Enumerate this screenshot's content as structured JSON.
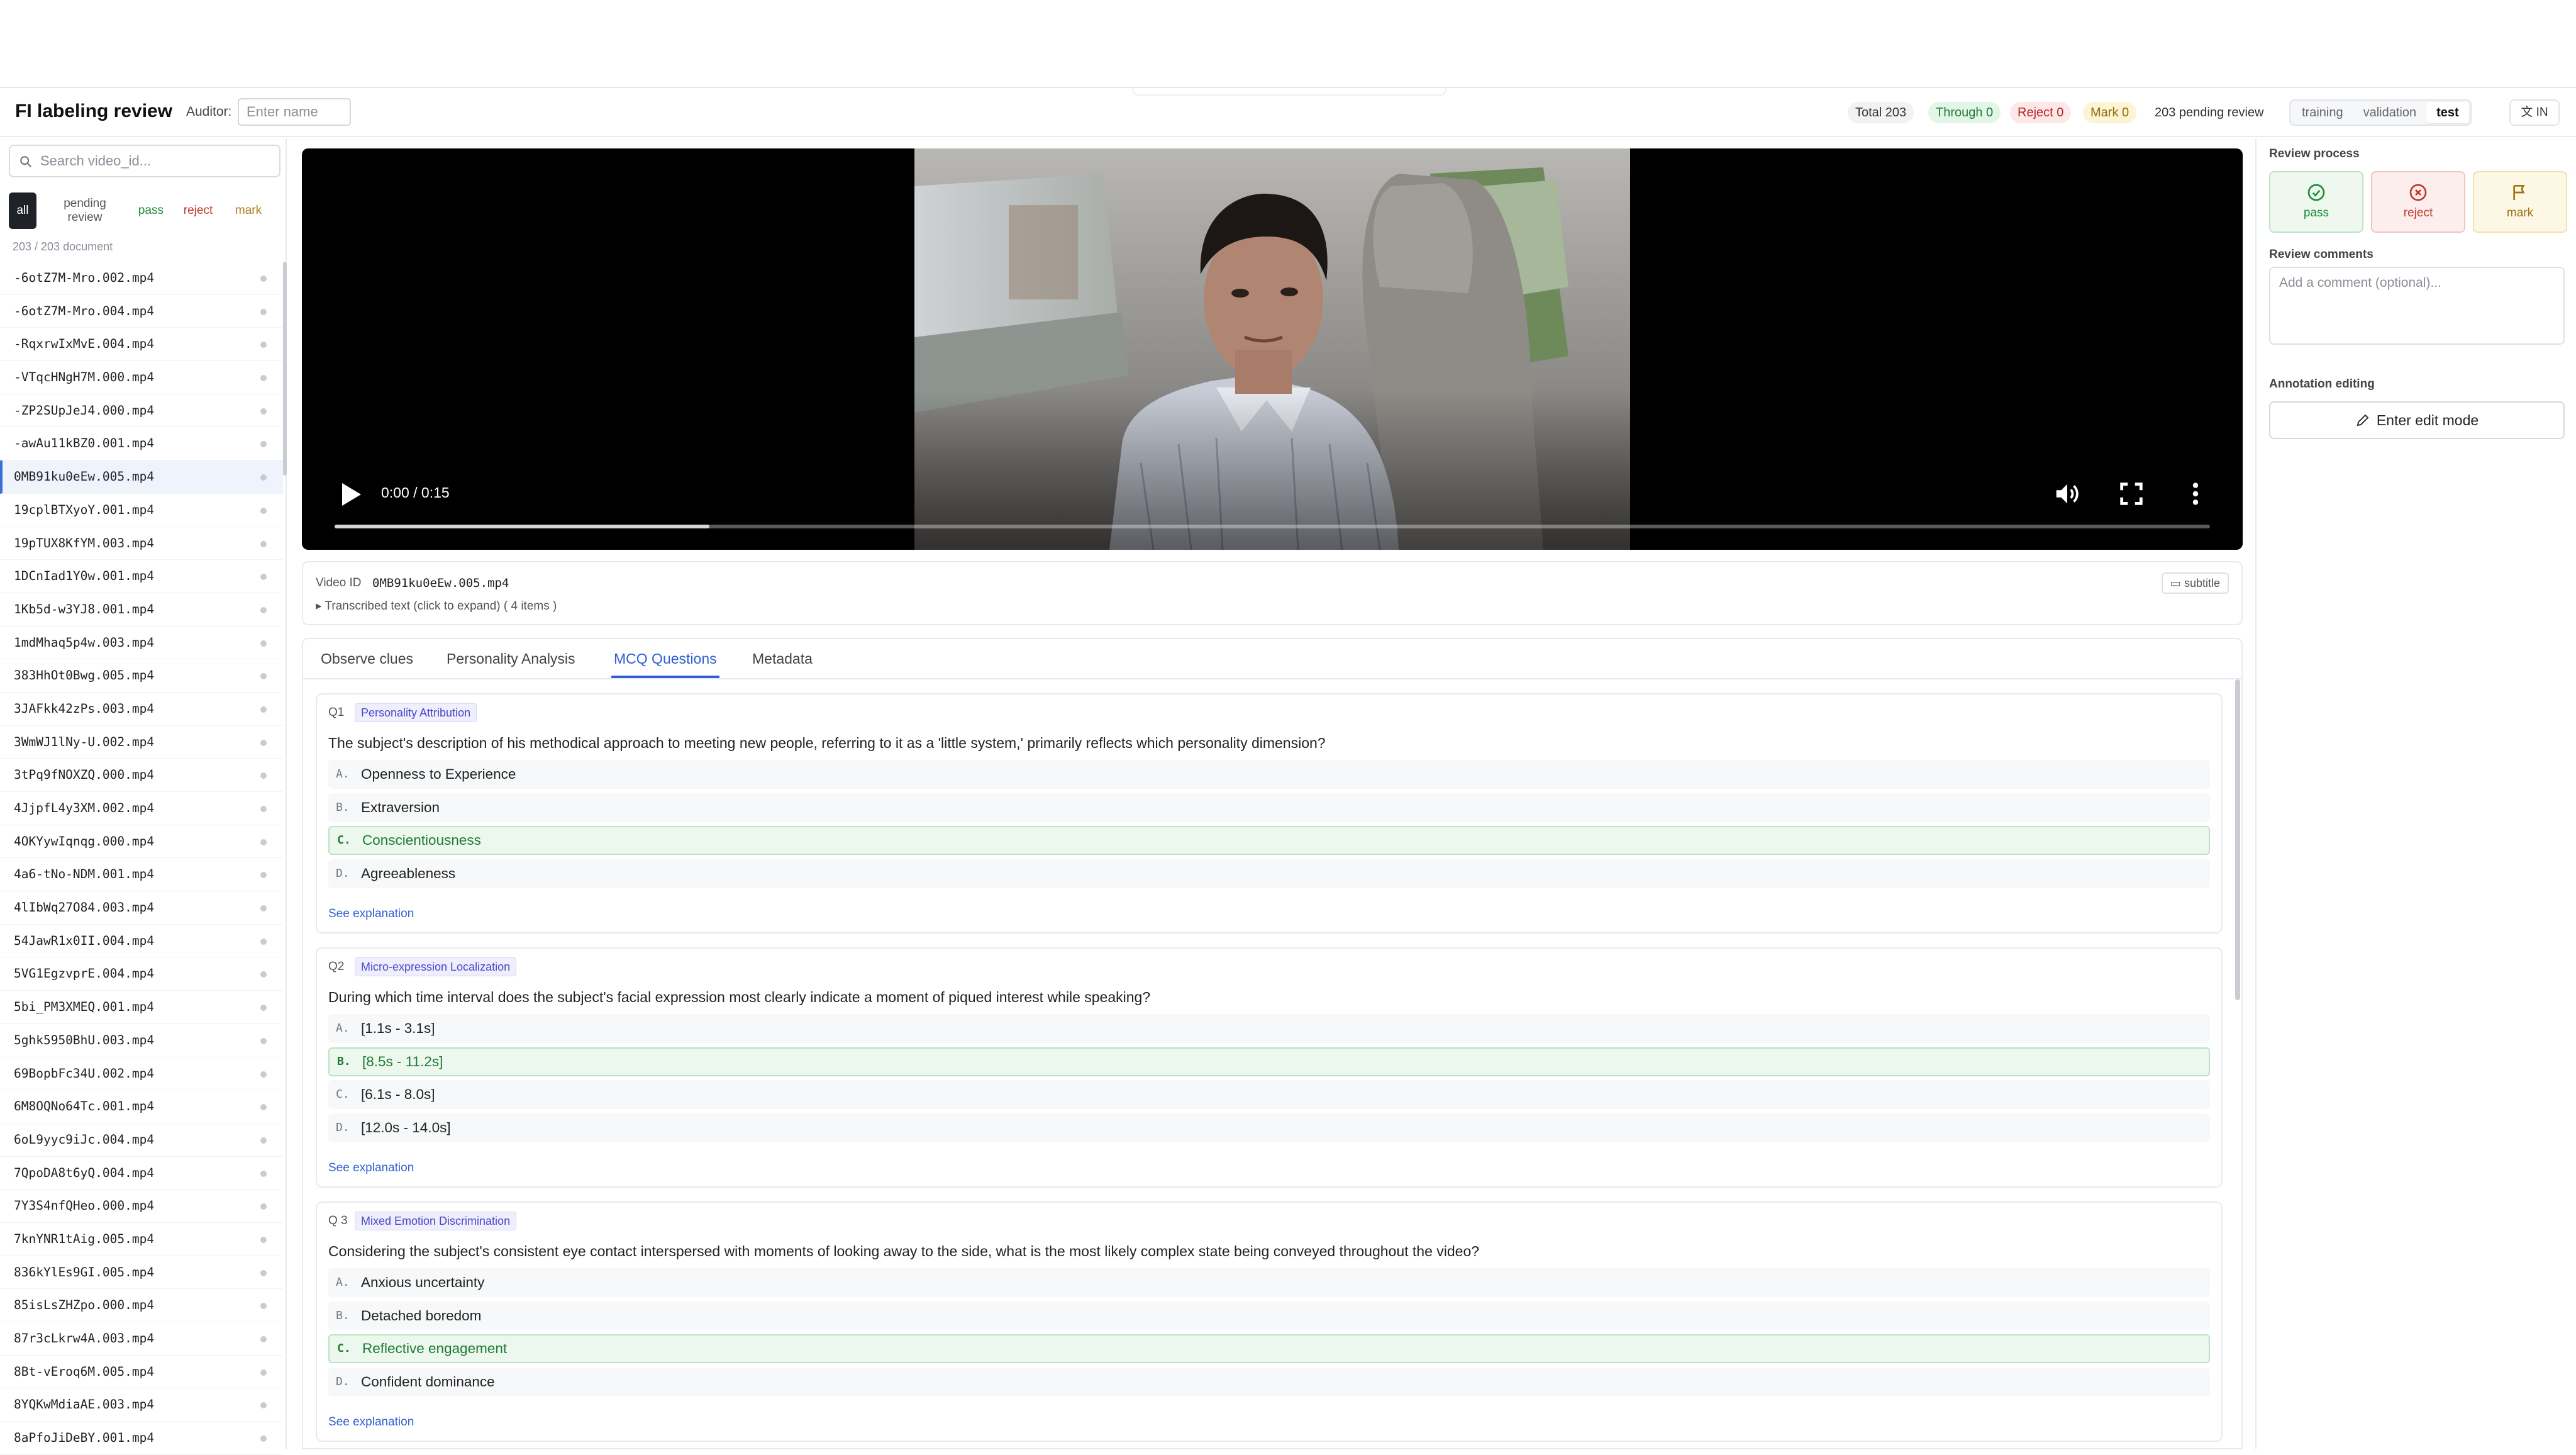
{
  "header": {
    "title": "FI labeling review",
    "auditor_label": "Auditor:",
    "auditor_placeholder": "Enter name",
    "stats": {
      "total": "Total 203",
      "through": "Through 0",
      "reject": "Reject 0",
      "mark": "Mark 0",
      "pending": "203 pending review"
    },
    "splits": [
      "training",
      "validation",
      "test"
    ],
    "active_split": "test",
    "language_button": "IN"
  },
  "sidebar": {
    "search_placeholder": "Search video_id...",
    "filters": {
      "all": "all",
      "pending": "pending review",
      "pass": "pass",
      "reject": "reject",
      "mark": "mark"
    },
    "doc_count": "203 / 203 document",
    "active_file": "0MB91ku0eEw.005.mp4",
    "files": [
      "-6otZ7M-Mro.002.mp4",
      "-6otZ7M-Mro.004.mp4",
      "-RqxrwIxMvE.004.mp4",
      "-VTqcHNgH7M.000.mp4",
      "-ZP2SUpJeJ4.000.mp4",
      "-awAu11kBZ0.001.mp4",
      "0MB91ku0eEw.005.mp4",
      "19cplBTXyoY.001.mp4",
      "19pTUX8KfYM.003.mp4",
      "1DCnIad1Y0w.001.mp4",
      "1Kb5d-w3YJ8.001.mp4",
      "1mdMhaq5p4w.003.mp4",
      "383HhOt0Bwg.005.mp4",
      "3JAFkk42zPs.003.mp4",
      "3WmWJ1lNy-U.002.mp4",
      "3tPq9fNOXZQ.000.mp4",
      "4JjpfL4y3XM.002.mp4",
      "4OKYywIqnqg.000.mp4",
      "4a6-tNo-NDM.001.mp4",
      "4lIbWq27O84.003.mp4",
      "54JawR1x0II.004.mp4",
      "5VG1EgzvprE.004.mp4",
      "5bi_PM3XMEQ.001.mp4",
      "5ghk5950BhU.003.mp4",
      "69BopbFc34U.002.mp4",
      "6M8OQNo64Tc.001.mp4",
      "6oL9yyc9iJc.004.mp4",
      "7QpoDA8t6yQ.004.mp4",
      "7Y3S4nfQHeo.000.mp4",
      "7knYNR1tAig.005.mp4",
      "836kYlEs9GI.005.mp4",
      "85isLsZHZpo.000.mp4",
      "87r3cLkrw4A.003.mp4",
      "8Bt-vEroq6M.005.mp4",
      "8YQKwMdiaAE.003.mp4",
      "8aPfoJiDeBY.001.mp4"
    ]
  },
  "player": {
    "time": "0:00 / 0:15",
    "progress_fraction": 0.2
  },
  "video_info": {
    "id_label": "Video ID",
    "id_value": "0MB91ku0eEw.005.mp4",
    "transcript_toggle": "▸ Transcribed text (click to expand) ( 4 items )",
    "subtitle_button": "subtitle"
  },
  "tabs": [
    "Observe clues",
    "Personality Analysis",
    "MCQ Questions",
    "Metadata"
  ],
  "active_tab": "MCQ Questions",
  "questions": [
    {
      "num": "Q1",
      "tag": "Personality Attribution",
      "text": "The subject's description of his methodical approach to meeting new people, referring to it as a 'little system,' primarily reflects which personality dimension?",
      "options": [
        {
          "letter": "A.",
          "text": "Openness to Experience"
        },
        {
          "letter": "B.",
          "text": "Extraversion"
        },
        {
          "letter": "C.",
          "text": "Conscientiousness"
        },
        {
          "letter": "D.",
          "text": "Agreeableness"
        }
      ],
      "correct": 2,
      "explain": "See explanation"
    },
    {
      "num": "Q2",
      "tag": "Micro-expression Localization",
      "text": "During which time interval does the subject's facial expression most clearly indicate a moment of piqued interest while speaking?",
      "options": [
        {
          "letter": "A.",
          "text": "[1.1s - 3.1s]"
        },
        {
          "letter": "B.",
          "text": "[8.5s - 11.2s]"
        },
        {
          "letter": "C.",
          "text": "[6.1s - 8.0s]"
        },
        {
          "letter": "D.",
          "text": "[12.0s - 14.0s]"
        }
      ],
      "correct": 1,
      "explain": "See explanation"
    },
    {
      "num": "Q 3",
      "tag": "Mixed Emotion Discrimination",
      "text": "Considering the subject's consistent eye contact interspersed with moments of looking away to the side, what is the most likely complex state being conveyed throughout the video?",
      "options": [
        {
          "letter": "A.",
          "text": "Anxious uncertainty"
        },
        {
          "letter": "B.",
          "text": "Detached boredom"
        },
        {
          "letter": "C.",
          "text": "Reflective engagement"
        },
        {
          "letter": "D.",
          "text": "Confident dominance"
        }
      ],
      "correct": 2,
      "explain": "See explanation"
    }
  ],
  "right_panel": {
    "review_process_label": "Review process",
    "pass_label": "pass",
    "reject_label": "reject",
    "mark_label": "mark",
    "comments_label": "Review comments",
    "comment_placeholder": "Add a comment (optional)...",
    "annotation_label": "Annotation editing",
    "edit_button": "Enter edit mode"
  },
  "colors": {
    "accent": "#2f5fd0",
    "pass": "#1f8a3a",
    "reject": "#c0392b",
    "mark": "#b7791f"
  }
}
